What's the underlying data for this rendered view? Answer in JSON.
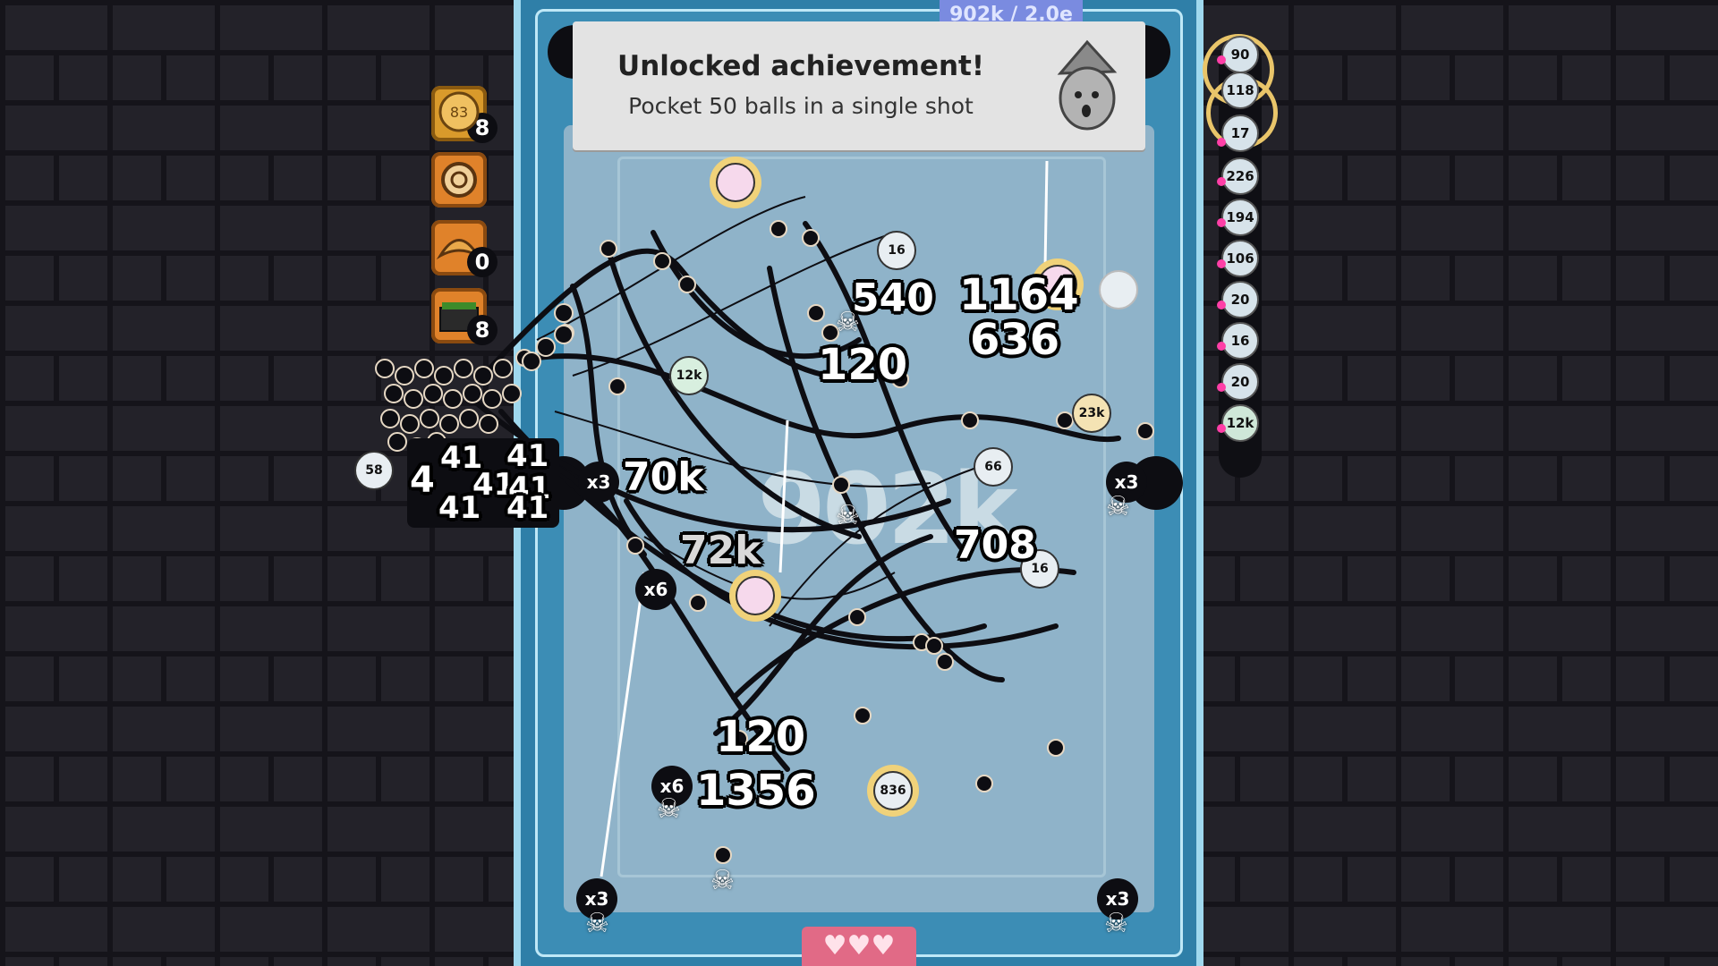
{
  "hud": {
    "target_score": "902k / 2.0e",
    "big_score": "902k",
    "lives": "♥♥♥"
  },
  "achievement": {
    "title": "Unlocked achievement!",
    "description": "Pocket 50 balls in a single shot"
  },
  "inventory": [
    {
      "name": "mooncake",
      "count": "8",
      "color": "#d99a2b"
    },
    {
      "name": "swiss-roll",
      "count": "",
      "color": "#d98a2b"
    },
    {
      "name": "croissant",
      "count": "0",
      "color": "#d98a2b"
    },
    {
      "name": "matcha-cake",
      "count": "8",
      "color": "#d98a2b"
    }
  ],
  "ball_queue": [
    "90",
    "118",
    "17",
    "226",
    "194",
    "106",
    "20",
    "16",
    "20",
    "12k"
  ],
  "score_popups": {
    "p540": "540",
    "p1164": "1164",
    "p636": "636",
    "p120a": "120",
    "p70k": "70k",
    "p72k": "72k",
    "p708": "708",
    "p120b": "120",
    "p1356": "1356",
    "p4": "4",
    "p41a": "41",
    "p41b": "41",
    "p41c": "41",
    "p41d": "41",
    "p41e": "41",
    "p41f": "41"
  },
  "multipliers": {
    "m1": "x3",
    "m2": "x6",
    "m3": "x6",
    "m4": "x3",
    "m5": "x3",
    "m6": "x3"
  },
  "balls": {
    "b16": "16",
    "b12k": "12k",
    "b66": "66",
    "b23k": "23k",
    "b836": "836",
    "b58": "58",
    "b16b": "16"
  },
  "colors": {
    "felt": "#8fb3c9",
    "rail": "#3c8db5",
    "gold": "#f0d27a",
    "lives": "#e16a86"
  }
}
